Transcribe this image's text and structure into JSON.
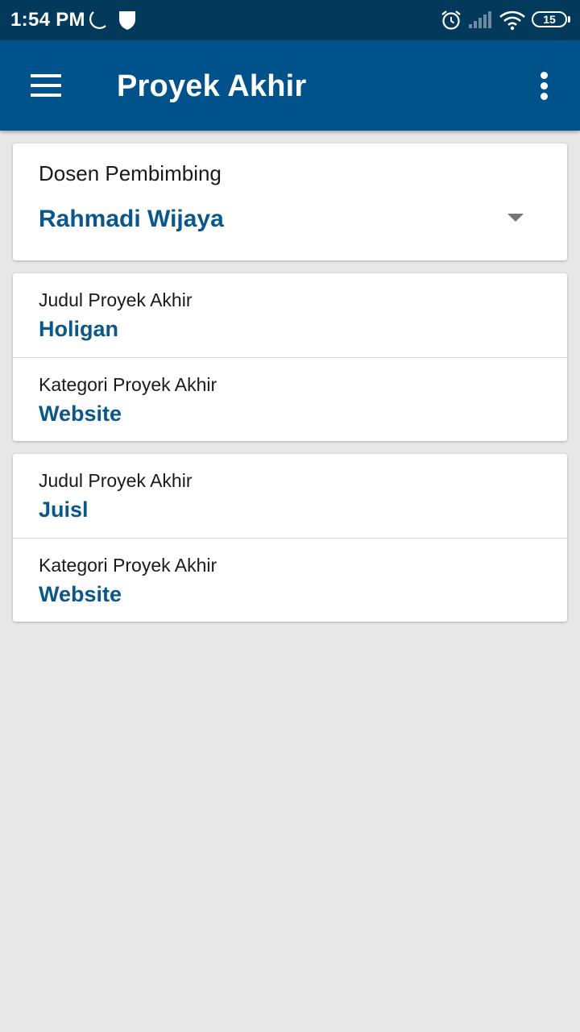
{
  "status_bar": {
    "time": "1:54 PM",
    "battery": "15",
    "icons": [
      "moon-icon",
      "shield-icon",
      "alarm-icon",
      "signal-icon",
      "wifi-icon",
      "battery-icon"
    ]
  },
  "app_bar": {
    "title": "Proyek Akhir",
    "menu_icon": "hamburger-menu-icon",
    "overflow_icon": "more-vert-icon"
  },
  "dosen": {
    "label": "Dosen Pembimbing",
    "value": "Rahmadi Wijaya"
  },
  "projects": [
    {
      "judul_label": "Judul Proyek Akhir",
      "judul": "Holigan",
      "kategori_label": "Kategori Proyek Akhir",
      "kategori": "Website"
    },
    {
      "judul_label": "Judul Proyek Akhir",
      "judul": "Juisl",
      "kategori_label": "Kategori Proyek Akhir",
      "kategori": "Website"
    }
  ],
  "colors": {
    "status_bar": "#033a5c",
    "app_bar": "#00538a",
    "accent_text": "#0a578c",
    "background": "#e8e7e8"
  }
}
